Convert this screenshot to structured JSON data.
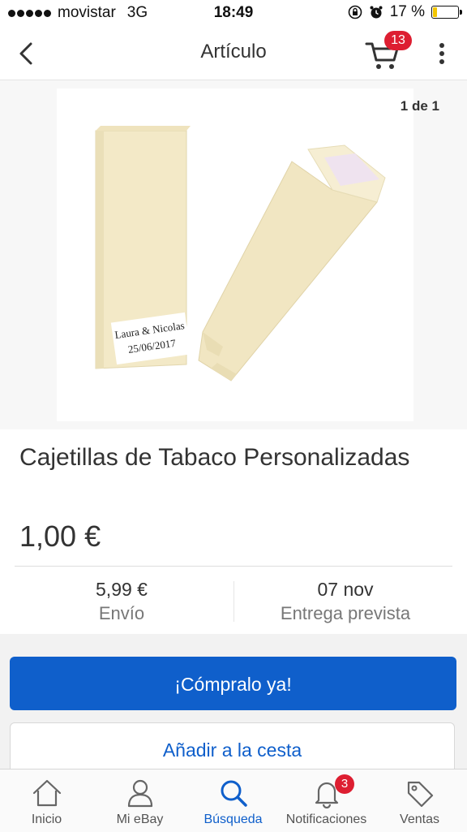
{
  "status_bar": {
    "carrier": "movistar",
    "network": "3G",
    "time": "18:49",
    "battery_percent": "17 %",
    "battery_level": 0.17,
    "battery_color": "#f2c500",
    "icons": [
      "signal-dots-icon",
      "rotation-lock-icon",
      "alarm-icon",
      "battery-icon"
    ]
  },
  "nav": {
    "title": "Artículo",
    "cart_count": "13",
    "icons": [
      "back-chevron-icon",
      "cart-icon",
      "more-vertical-icon"
    ]
  },
  "image": {
    "counter": "1 de 1",
    "label_line1": "Laura & Nicolas",
    "label_line2": "25/06/2017"
  },
  "product": {
    "title": "Cajetillas de Tabaco Personalizadas",
    "price": "1,00 €"
  },
  "shipping": {
    "cost": "5,99 €",
    "cost_label": "Envío",
    "date": "07 nov",
    "date_label": "Entrega prevista"
  },
  "actions": {
    "buy_now": "¡Cómpralo ya!",
    "add_to_cart": "Añadir a la cesta"
  },
  "tabs": [
    {
      "label": "Inicio",
      "icon": "home-icon"
    },
    {
      "label": "Mi eBay",
      "icon": "person-icon"
    },
    {
      "label": "Búsqueda",
      "icon": "search-icon",
      "active": true
    },
    {
      "label": "Notificaciones",
      "icon": "bell-icon",
      "badge": "3"
    },
    {
      "label": "Ventas",
      "icon": "tag-icon"
    }
  ],
  "colors": {
    "accent_blue": "#0f5fcb",
    "badge_red": "#dd1e31",
    "text": "#333333",
    "muted_text": "#777777"
  }
}
